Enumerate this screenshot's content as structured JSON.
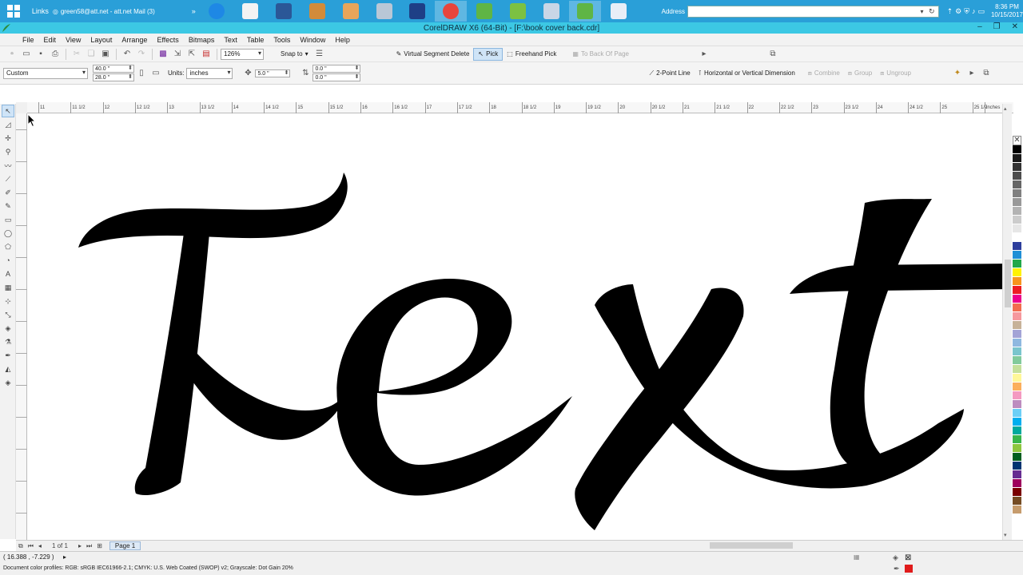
{
  "taskbar": {
    "links_label": "Links",
    "mail_label": "green58@att.net - att.net Mail (3)",
    "overflow": "»",
    "address_label": "Address",
    "address_value": "",
    "clock_time": "8:36 PM",
    "clock_date": "10/15/2017",
    "apps": [
      "internet-explorer",
      "calendar-app",
      "word",
      "paint-app",
      "pen-app",
      "printer-app",
      "s-app",
      "chrome",
      "leaf-app-1",
      "leaf-app-2",
      "globe-app",
      "leaf-app-3",
      "document-app"
    ]
  },
  "title": "CorelDRAW X6 (64-Bit) - [F:\\book cover back.cdr]",
  "menu": [
    "File",
    "Edit",
    "View",
    "Layout",
    "Arrange",
    "Effects",
    "Bitmaps",
    "Text",
    "Table",
    "Tools",
    "Window",
    "Help"
  ],
  "standard_toolbar": {
    "zoom": "126%",
    "snap_to": "Snap to",
    "virtual_segment_delete": "Virtual Segment Delete",
    "pick": "Pick",
    "freehand_pick": "Freehand Pick",
    "to_back_of_page": "To Back Of Page"
  },
  "property_bar": {
    "page_preset": "Custom",
    "width": "40.0 \"",
    "height": "28.0 \"",
    "units_label": "Units:",
    "units_value": "inches",
    "nudge": "5.0 \"",
    "dup_x": "0.0 \"",
    "dup_y": "0.0 \"",
    "two_point_line": "2-Point Line",
    "dimension": "Horizontal or Vertical Dimension",
    "combine": "Combine",
    "group": "Group",
    "ungroup": "Ungroup"
  },
  "ruler": {
    "labels": [
      "11",
      "11 1/2",
      "12",
      "12 1/2",
      "13",
      "13 1/2",
      "14",
      "14 1/2",
      "15",
      "15 1/2",
      "16",
      "16 1/2",
      "17",
      "17 1/2",
      "18",
      "18 1/2",
      "19",
      "19 1/2",
      "20",
      "20 1/2",
      "21",
      "21 1/2",
      "22",
      "22 1/2",
      "23",
      "23 1/2",
      "24",
      "24 1/2",
      "25",
      "25 1/2"
    ],
    "unit": "inches"
  },
  "page_navigator": {
    "page_count": "1 of 1",
    "tab": "Page 1"
  },
  "status": {
    "coordinates": "( 16.388 , -7.229 )",
    "color_profiles": "Document color profiles: RGB: sRGB IEC61966-2.1; CMYK: U.S. Web Coated (SWOP) v2; Grayscale: Dot Gain 20%",
    "fill_color": "#e01b1b"
  },
  "palette": [
    "#000000",
    "#1a1a1a",
    "#333333",
    "#4d4d4d",
    "#666666",
    "#808080",
    "#999999",
    "#b3b3b3",
    "#cccccc",
    "#e6e6e6",
    "#ffffff",
    "#2d3e9c",
    "#1f8fd6",
    "#22a84a",
    "#fff200",
    "#f7941d",
    "#ed1c24",
    "#ec008c",
    "#f26c4f",
    "#f6989d",
    "#c7b299",
    "#a3a3d6",
    "#8fb8e0",
    "#7ac5cd",
    "#82ca9c",
    "#c4df9b",
    "#fff799",
    "#fbaf5d",
    "#f49ac1",
    "#bd8cbf",
    "#6dcff6",
    "#00aeef",
    "#00a99d",
    "#39b54a",
    "#8dc63f",
    "#005e20",
    "#003471",
    "#662d91",
    "#9e005d",
    "#790000",
    "#754c24",
    "#c69c6d"
  ]
}
